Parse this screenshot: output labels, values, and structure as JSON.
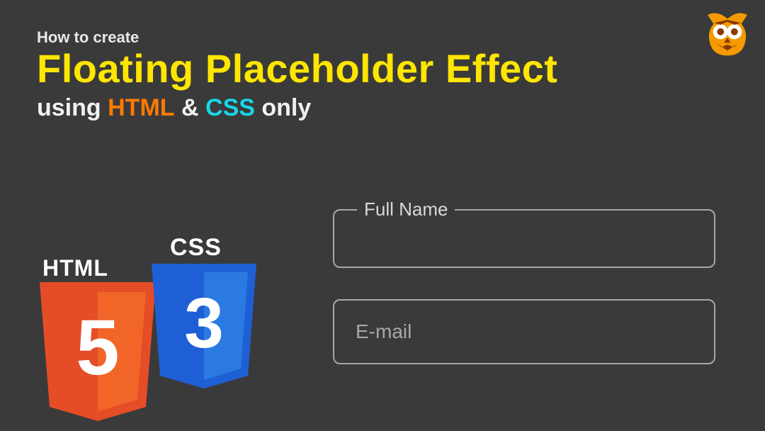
{
  "heading": {
    "pre": "How to create",
    "main": "Floating Placeholder Effect",
    "sub_using": "using",
    "sub_html": "HTML",
    "sub_amp": "&",
    "sub_css": "CSS",
    "sub_only": "only"
  },
  "logos": {
    "html_label": "HTML",
    "css_label": "CSS",
    "html_glyph": "5",
    "css_glyph": "3"
  },
  "form": {
    "fullname_label": "Full Name",
    "email_placeholder": "E-mail"
  },
  "colors": {
    "bg": "#3a3a3a",
    "accent_yellow": "#ffe600",
    "accent_html": "#ff7a00",
    "accent_css": "#18d6e8",
    "input_border": "#a7a7a7"
  }
}
